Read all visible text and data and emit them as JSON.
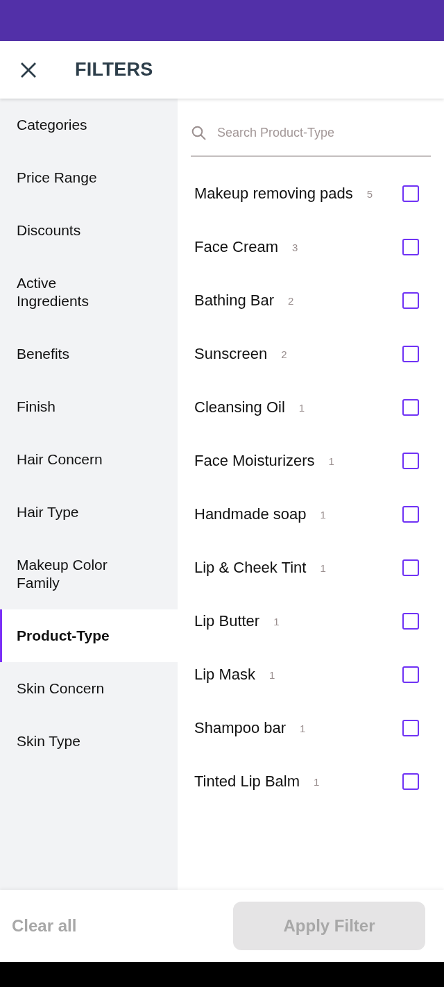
{
  "header": {
    "title": "FILTERS"
  },
  "sidebar": {
    "items": [
      {
        "label": "Categories",
        "selected": false
      },
      {
        "label": "Price Range",
        "selected": false
      },
      {
        "label": "Discounts",
        "selected": false
      },
      {
        "label": "Active Ingredients",
        "selected": false
      },
      {
        "label": "Benefits",
        "selected": false
      },
      {
        "label": "Finish",
        "selected": false
      },
      {
        "label": "Hair Concern",
        "selected": false
      },
      {
        "label": "Hair Type",
        "selected": false
      },
      {
        "label": "Makeup Color Family",
        "selected": false
      },
      {
        "label": "Product-Type",
        "selected": true
      },
      {
        "label": "Skin Concern",
        "selected": false
      },
      {
        "label": "Skin Type",
        "selected": false
      }
    ]
  },
  "search": {
    "placeholder": "Search Product-Type"
  },
  "options": [
    {
      "label": "Makeup removing pads",
      "count": "5",
      "checked": false
    },
    {
      "label": "Face Cream",
      "count": "3",
      "checked": false
    },
    {
      "label": "Bathing Bar",
      "count": "2",
      "checked": false
    },
    {
      "label": "Sunscreen",
      "count": "2",
      "checked": false
    },
    {
      "label": "Cleansing Oil",
      "count": "1",
      "checked": false
    },
    {
      "label": "Face Moisturizers",
      "count": "1",
      "checked": false
    },
    {
      "label": "Handmade soap",
      "count": "1",
      "checked": false
    },
    {
      "label": "Lip & Cheek Tint",
      "count": "1",
      "checked": false
    },
    {
      "label": "Lip Butter",
      "count": "1",
      "checked": false
    },
    {
      "label": "Lip Mask",
      "count": "1",
      "checked": false
    },
    {
      "label": "Shampoo bar",
      "count": "1",
      "checked": false
    },
    {
      "label": "Tinted Lip Balm",
      "count": "1",
      "checked": false
    }
  ],
  "footer": {
    "clear_all": {
      "label": "Clear all",
      "disabled": true
    },
    "apply_button": {
      "label": "Apply Filter",
      "disabled": true
    }
  }
}
